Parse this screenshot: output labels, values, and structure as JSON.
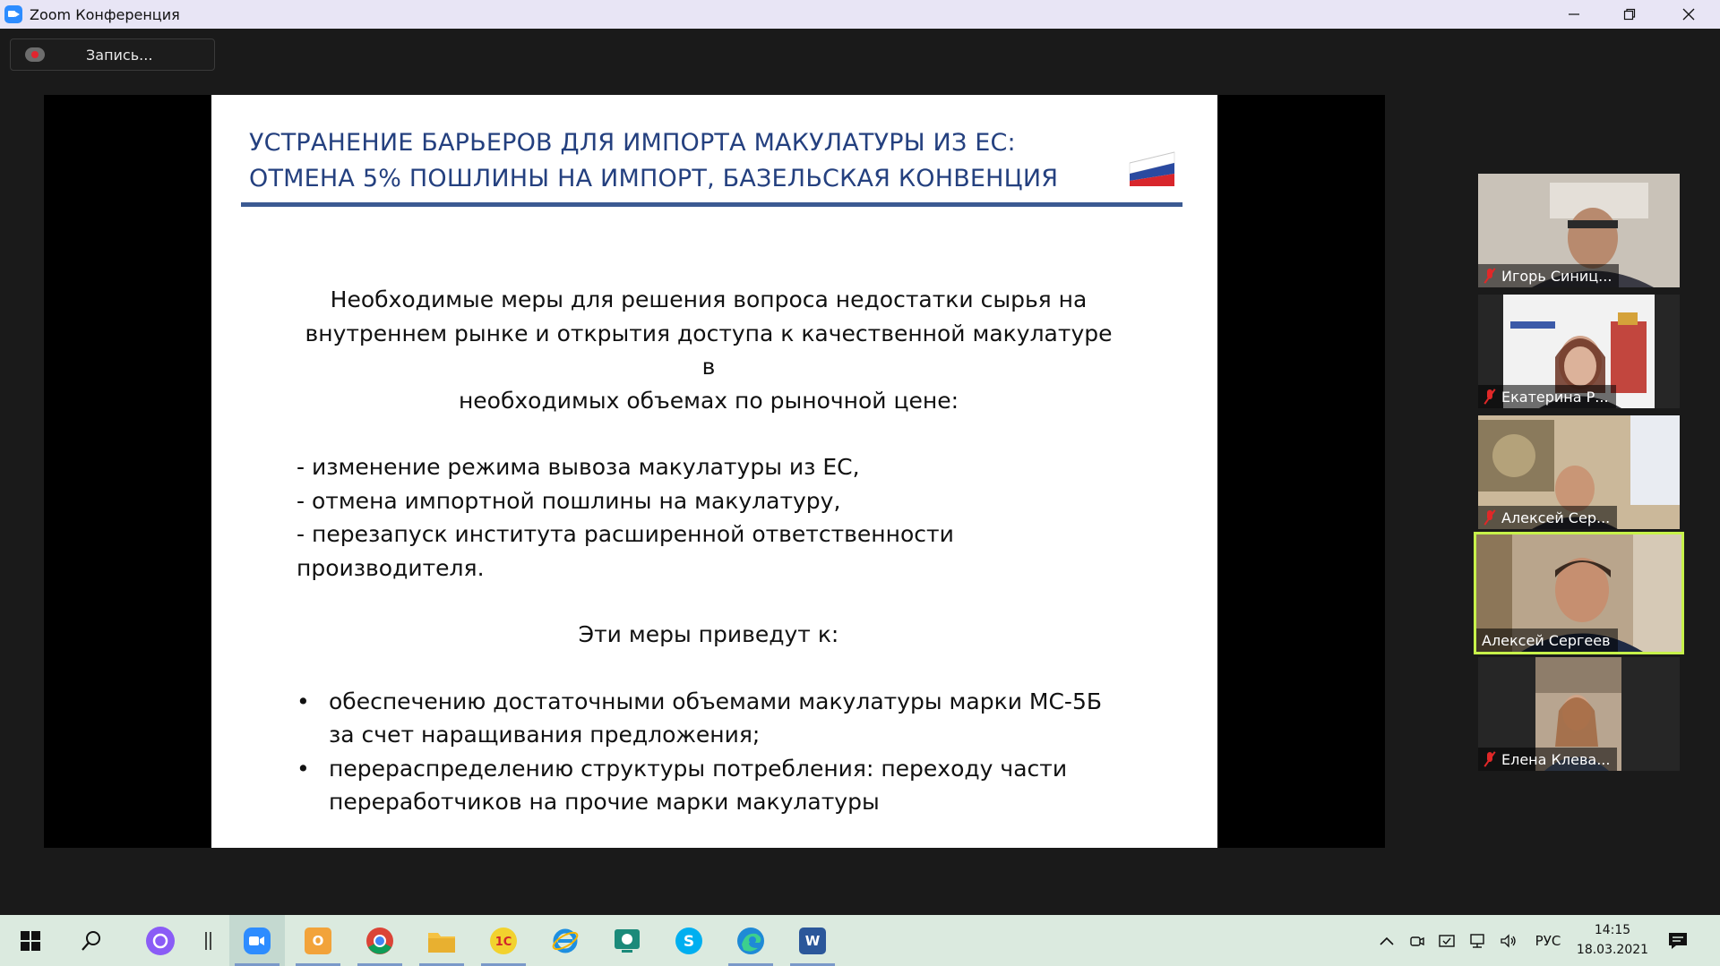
{
  "window": {
    "title": "Zoom Конференция"
  },
  "toolbar": {
    "record_label": "Запись..."
  },
  "slide": {
    "title_line1": "УСТРАНЕНИЕ БАРЬЕРОВ ДЛЯ ИМПОРТА МАКУЛАТУРЫ ИЗ ЕС:",
    "title_line2": "ОТМЕНА 5% ПОШЛИНЫ НА ИМПОРТ, БАЗЕЛЬСКАЯ КОНВЕНЦИЯ",
    "intro_line1": "Необходимые меры для решения вопроса недостатки сырья на",
    "intro_line2": "внутреннем рынке и открытия доступа к качественной макулатуре в",
    "intro_line3": "необходимых объемах по рыночной цене:",
    "measures": [
      "- изменение режима вывоза макулатуры из ЕС,",
      "- отмена импортной пошлины на макулатуру,",
      "- перезапуск института расширенной ответственности",
      "производителя."
    ],
    "results_heading": "Эти меры приведут к:",
    "results": [
      {
        "line1": "обеспечению достаточными объемами макулатуры марки МС-5Б",
        "line2": "за счет наращивания предложения;"
      },
      {
        "line1": "перераспределению структуры потребления: переходу части",
        "line2": "переработчиков на прочие марки макулатуры"
      }
    ],
    "flag_icon": "russian-flag-icon"
  },
  "participants": [
    {
      "name": "Игорь Синиц...",
      "muted": true,
      "active": false
    },
    {
      "name": "Екатерина Р...",
      "muted": true,
      "active": false
    },
    {
      "name": "Алексей Сер...",
      "muted": true,
      "active": false
    },
    {
      "name": "Алексей Сергеев",
      "muted": false,
      "active": true
    },
    {
      "name": "Елена Клева...",
      "muted": true,
      "active": false
    }
  ],
  "taskbar": {
    "language": "РУС",
    "time": "14:15",
    "date": "18.03.2021"
  },
  "colors": {
    "slide_title": "#24407f",
    "active_speaker_border": "#c7f24a",
    "muted_mic": "#e02828",
    "taskbar_bg": "#dbeadf"
  }
}
